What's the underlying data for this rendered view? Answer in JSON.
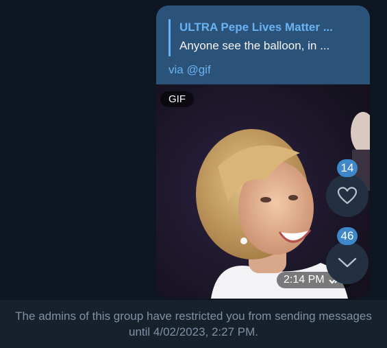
{
  "message": {
    "reply": {
      "author": "ULTRA Pepe Lives Matter ...",
      "text": "Anyone see the balloon, in ..."
    },
    "via_label": "via @gif",
    "media_badge": "GIF",
    "time": "2:14 PM"
  },
  "reactions": {
    "like_count": "14",
    "scroll_down_count": "46"
  },
  "footer": {
    "restriction_text": "The admins of this group have restricted you from sending messages until 4/02/2023, 2:27 PM."
  },
  "colors": {
    "background": "#0e1621",
    "bubble": "#2b5278",
    "link": "#6ab3f3",
    "badge": "#3e88c9",
    "footer_bg": "#17212b",
    "footer_text": "#7f91a4"
  }
}
